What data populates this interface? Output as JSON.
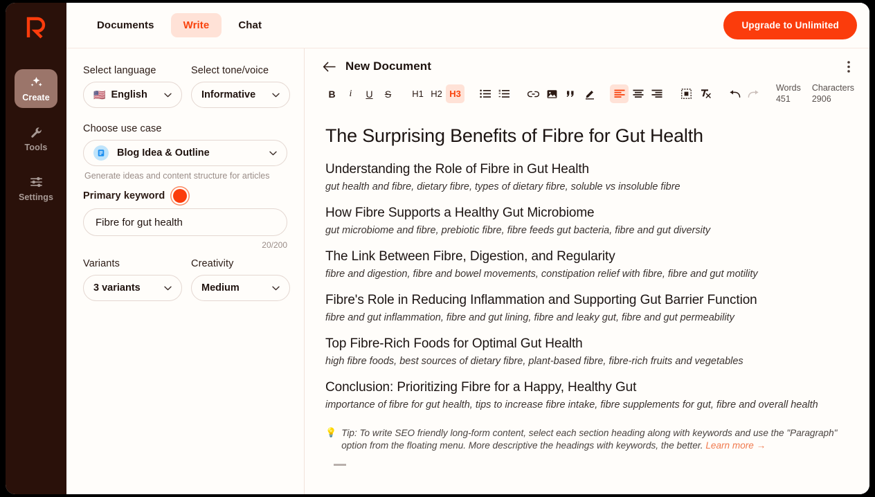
{
  "brand": {
    "logo_letter": "R",
    "accent": "#fb3c0c",
    "sidebar_bg": "#2a110a"
  },
  "sidebar": {
    "items": [
      {
        "label": "Create",
        "icon": "sparkles-icon",
        "active": true
      },
      {
        "label": "Tools",
        "icon": "wrench-icon",
        "active": false
      },
      {
        "label": "Settings",
        "icon": "sliders-icon",
        "active": false
      }
    ]
  },
  "topbar": {
    "tabs": [
      {
        "label": "Documents",
        "active": false
      },
      {
        "label": "Write",
        "active": true
      },
      {
        "label": "Chat",
        "active": false
      }
    ],
    "upgrade_label": "Upgrade to Unlimited"
  },
  "panel": {
    "language": {
      "label": "Select language",
      "value": "English",
      "flag": "🇺🇸"
    },
    "tone": {
      "label": "Select tone/voice",
      "value": "Informative"
    },
    "use_case": {
      "label": "Choose use case",
      "value": "Blog Idea & Outline",
      "hint": "Generate ideas and content structure for articles",
      "icon": "blog-document-icon"
    },
    "primary_keyword": {
      "label": "Primary keyword",
      "value": "Fibre for gut health",
      "counter": "20/200"
    },
    "variants": {
      "label": "Variants",
      "value": "3 variants"
    },
    "creativity": {
      "label": "Creativity",
      "value": "Medium"
    }
  },
  "editor": {
    "back_icon": "back-arrow-icon",
    "doc_title": "New Document",
    "kebab_icon": "more-vertical-icon",
    "toolbar": {
      "bold": "B",
      "italic": "i",
      "underline": "U",
      "strike": "S",
      "h1": "H1",
      "h2": "H2",
      "h3": "H3",
      "bullet_list": "bullet-list-icon",
      "numbered_list": "numbered-list-icon",
      "link": "link-icon",
      "image": "image-icon",
      "quote": "quote-icon",
      "highlight": "highlighter-icon",
      "align_left": "align-left-icon",
      "align_center": "align-center-icon",
      "align_right": "align-right-icon",
      "frame": "frame-icon",
      "clear_format": "clear-formatting-icon",
      "undo": "undo-icon",
      "redo": "redo-icon",
      "active": [
        "h3",
        "align_left"
      ],
      "disabled": [
        "redo"
      ]
    },
    "stats": {
      "words_label": "Words",
      "words_value": "451",
      "characters_label": "Characters",
      "characters_value": "2906"
    },
    "document": {
      "title": "The Surprising Benefits of Fibre for Gut Health",
      "sections": [
        {
          "heading": "Understanding the Role of Fibre in Gut Health",
          "keywords": "gut health and fibre, dietary fibre, types of dietary fibre, soluble vs insoluble fibre"
        },
        {
          "heading": "How Fibre Supports a Healthy Gut Microbiome",
          "keywords": "gut microbiome and fibre, prebiotic fibre, fibre feeds gut bacteria, fibre and gut diversity"
        },
        {
          "heading": "The Link Between Fibre, Digestion, and Regularity",
          "keywords": "fibre and digestion, fibre and bowel movements, constipation relief with fibre, fibre and gut motility"
        },
        {
          "heading": "Fibre's Role in Reducing Inflammation and Supporting Gut Barrier Function",
          "keywords": "fibre and gut inflammation, fibre and gut lining, fibre and leaky gut, fibre and gut permeability"
        },
        {
          "heading": "Top Fibre-Rich Foods for Optimal Gut Health",
          "keywords": "high fibre foods, best sources of dietary fibre, plant-based fibre, fibre-rich fruits and vegetables"
        },
        {
          "heading": "Conclusion: Prioritizing Fibre for a Happy, Healthy Gut",
          "keywords": "importance of fibre for gut health, tips to increase fibre intake, fibre supplements for gut, fibre and overall health"
        }
      ],
      "tip": {
        "icon": "lightbulb-icon",
        "text": "Tip: To write SEO friendly long-form content, select each section heading along with keywords and use the \"Paragraph\" option from the floating menu. More descriptive the headings with keywords, the better. ",
        "link_text": "Learn more →"
      }
    }
  }
}
